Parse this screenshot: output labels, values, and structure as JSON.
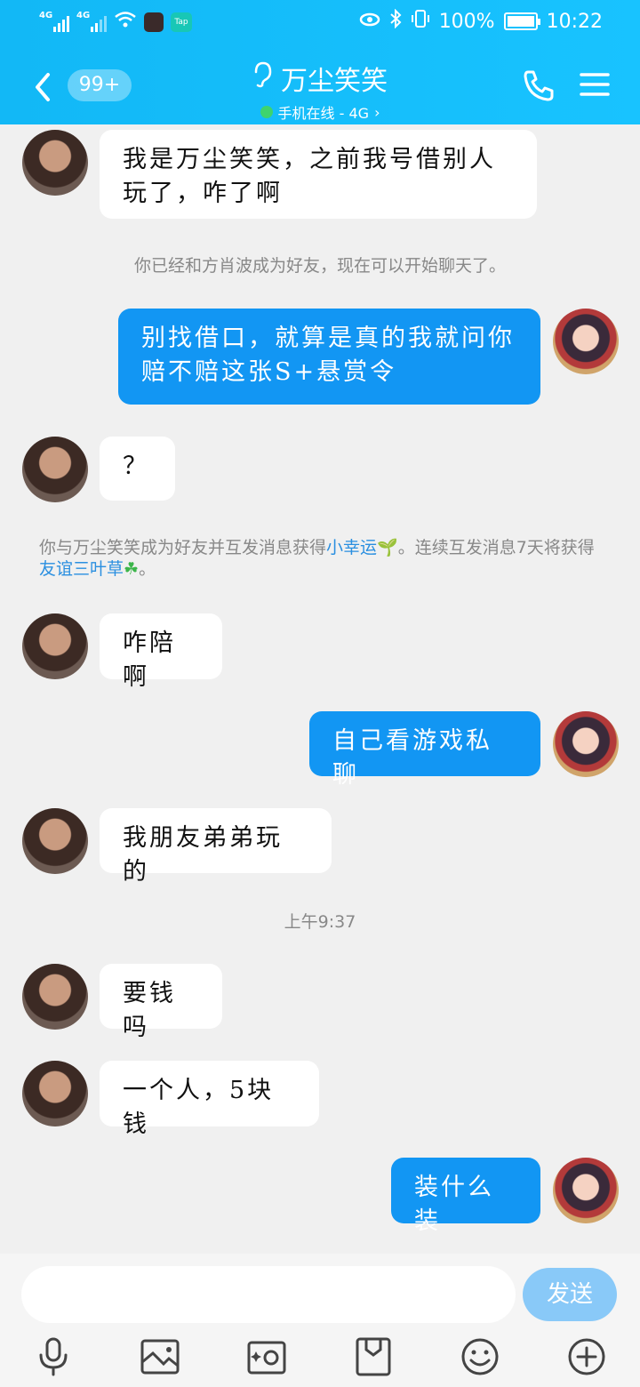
{
  "status": {
    "net1": "4G",
    "net2": "4G",
    "tap": "Tap",
    "battery": "100%",
    "time": "10:22",
    "battery_level": 100
  },
  "header": {
    "unread_badge": "99+",
    "title": "万尘笑笑",
    "subtitle": "手机在线 - 4G",
    "chevron": "›"
  },
  "messages": [
    {
      "side": "in",
      "text": "我是万尘笑笑，之前我号借别人玩了，咋了啊"
    },
    {
      "type": "system",
      "text": "你已经和方肖波成为好友，现在可以开始聊天了。"
    },
    {
      "side": "out",
      "text": "别找借口，就算是真的我就问你赔不赔这张S+悬赏令"
    },
    {
      "side": "in",
      "text": "？"
    },
    {
      "type": "system2",
      "p1": "你与万尘笑笑成为好友并互发消息获得",
      "link1": "小幸运",
      "icon1": "🌱",
      "p2": "。连续互发消息7天将获得",
      "link2": "友谊三叶草",
      "icon2": "☘",
      "p3": "。"
    },
    {
      "side": "in",
      "text": "咋陪啊"
    },
    {
      "side": "out",
      "text": "自己看游戏私聊"
    },
    {
      "side": "in",
      "text": "我朋友弟弟玩的"
    },
    {
      "type": "time",
      "text": "上午9:37"
    },
    {
      "side": "in",
      "text": "要钱吗"
    },
    {
      "side": "in",
      "text": "一个人，5块钱"
    },
    {
      "side": "out",
      "text": "装什么装"
    }
  ],
  "composer": {
    "send_label": "发送"
  },
  "colors": {
    "header": "#12b8f6",
    "outgoing_bubble": "#1296f3",
    "send_button": "#89c9f8",
    "link": "#2a8fe0"
  },
  "icons": [
    "voice-icon",
    "image-icon",
    "camera-icon",
    "file-icon",
    "emoji-icon",
    "plus-icon"
  ]
}
